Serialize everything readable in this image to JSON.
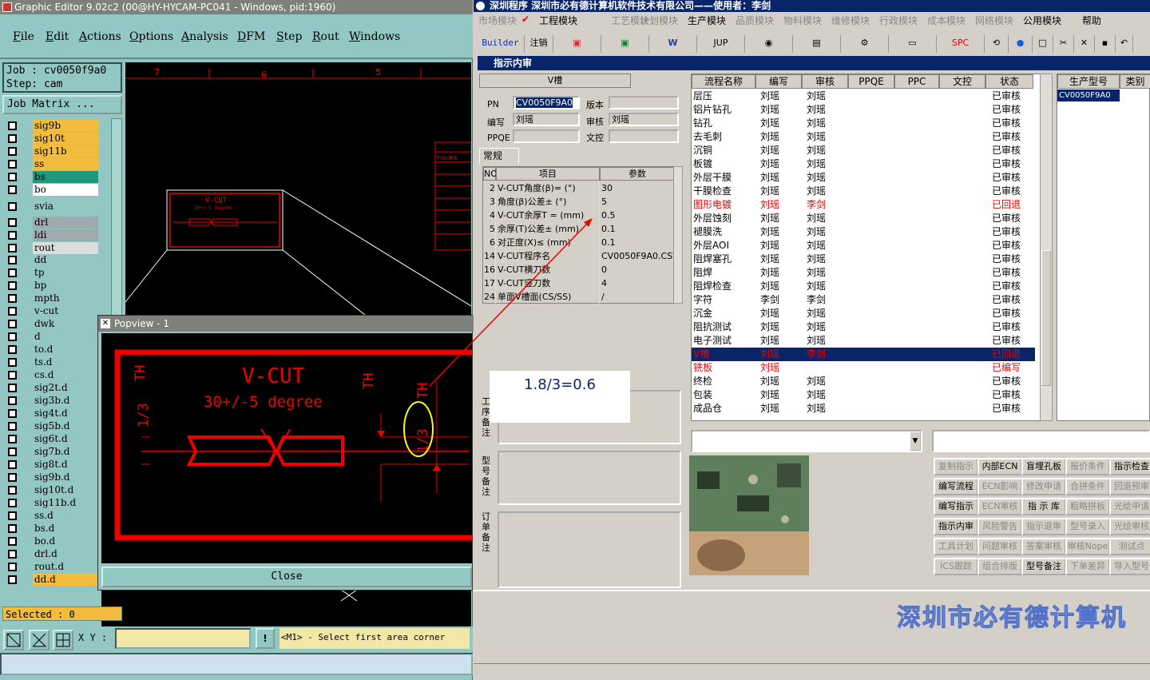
{
  "editor": {
    "title": "Graphic Editor 9.02c2 (00@HY-HYCAM-PC041 - Windows, pid:1960)",
    "menu": [
      "File",
      "Edit",
      "Actions",
      "Options",
      "Analysis",
      "DFM",
      "Step",
      "Rout",
      "Windows"
    ],
    "job": "Job : cv0050f9a0",
    "step": "Step: cam",
    "job_matrix": "Job Matrix ...",
    "layers": [
      {
        "name": "sig9b",
        "color": "#f3bc3c"
      },
      {
        "name": "sig10t",
        "color": "#f3bc3c"
      },
      {
        "name": "sig11b",
        "color": "#f3bc3c"
      },
      {
        "name": "ss",
        "color": "#f3bc3c"
      },
      {
        "name": "bs",
        "color": "#1b9a7c"
      },
      {
        "name": "bo",
        "color": "#ffffff"
      },
      {
        "name": "svia",
        "color": "#93c7c3"
      },
      {
        "name": "drl",
        "color": "#9fa9b0"
      },
      {
        "name": "ldi",
        "color": "#9fa9b0"
      },
      {
        "name": "rout",
        "color": "#dcdcdc"
      },
      {
        "name": "dd",
        "color": "#93c7c3"
      },
      {
        "name": "tp",
        "color": "#93c7c3"
      },
      {
        "name": "bp",
        "color": "#93c7c3"
      },
      {
        "name": "mpth",
        "color": "#93c7c3"
      },
      {
        "name": "v-cut",
        "color": "#93c7c3"
      },
      {
        "name": "dwk",
        "color": "#93c7c3"
      },
      {
        "name": "d",
        "color": "#93c7c3"
      },
      {
        "name": "to.d",
        "color": "#93c7c3"
      },
      {
        "name": "ts.d",
        "color": "#93c7c3"
      },
      {
        "name": "cs.d",
        "color": "#93c7c3"
      },
      {
        "name": "sig2t.d",
        "color": "#93c7c3"
      },
      {
        "name": "sig3b.d",
        "color": "#93c7c3"
      },
      {
        "name": "sig4t.d",
        "color": "#93c7c3"
      },
      {
        "name": "sig5b.d",
        "color": "#93c7c3"
      },
      {
        "name": "sig6t.d",
        "color": "#93c7c3"
      },
      {
        "name": "sig7b.d",
        "color": "#93c7c3"
      },
      {
        "name": "sig8t.d",
        "color": "#93c7c3"
      },
      {
        "name": "sig9b.d",
        "color": "#93c7c3"
      },
      {
        "name": "sig10t.d",
        "color": "#93c7c3"
      },
      {
        "name": "sig11b.d",
        "color": "#93c7c3"
      },
      {
        "name": "ss.d",
        "color": "#93c7c3"
      },
      {
        "name": "bs.d",
        "color": "#93c7c3"
      },
      {
        "name": "bo.d",
        "color": "#93c7c3"
      },
      {
        "name": "drl.d",
        "color": "#93c7c3"
      },
      {
        "name": "rout.d",
        "color": "#93c7c3"
      },
      {
        "name": "dd.d",
        "color": "#f3bc3c"
      }
    ],
    "selected": "Selected : 0",
    "xy_label": "X Y :",
    "status": "<M1> - Select first area corner",
    "ruler": [
      "7",
      "6",
      "5"
    ],
    "canvas_fig_label": "FIGURE",
    "popview": {
      "title": "Popview - 1",
      "vcut_title": "V-CUT",
      "vcut_sub": "30+/-5 degree",
      "th": "TH",
      "ratio": "1/3",
      "close": "Close"
    }
  },
  "app": {
    "title": "深圳程序    深圳市必有德计算机软件技术有限公司——使用者：李剑",
    "menu": [
      {
        "label": "市场模块",
        "active": false
      },
      {
        "label": "工程模块",
        "active": true
      },
      {
        "label": "工艺模块",
        "active": false
      },
      {
        "label": "计划模块",
        "active": false
      },
      {
        "label": "生产模块",
        "active": true
      },
      {
        "label": "品质模块",
        "active": false
      },
      {
        "label": "物料模块",
        "active": false
      },
      {
        "label": "维修模块",
        "active": false
      },
      {
        "label": "行政模块",
        "active": false
      },
      {
        "label": "成本模块",
        "active": false
      },
      {
        "label": "网络模块",
        "active": false
      },
      {
        "label": "公用模块",
        "active": true
      },
      {
        "label": "帮助",
        "active": true
      }
    ],
    "toolbar": [
      "Builder",
      "注销",
      "",
      "",
      "W",
      "JUP",
      "",
      "",
      "",
      "",
      "SPC",
      "",
      "",
      "",
      "",
      "",
      "",
      ""
    ],
    "subwindow_title": "指示内审",
    "form": {
      "heading": "V槽",
      "pn_label": "PN",
      "pn_value": "CV0050F9A0",
      "version_label": "版本",
      "version_value": "",
      "writer_label": "编写",
      "writer_value": "刘瑶",
      "review_label": "审核",
      "review_value": "刘瑶",
      "ppqe_label": "PPQE",
      "ppqe_value": "",
      "doc_label": "文控",
      "doc_value": ""
    },
    "tab_general": "常规",
    "params": {
      "headers": [
        "NO",
        "项目",
        "参数"
      ],
      "rows": [
        [
          "2",
          "V-CUT角度(β)=  (°)",
          "30"
        ],
        [
          "3",
          "角度(β)公差±  (°)",
          "5"
        ],
        [
          "4",
          "V-CUT余厚T =  (mm)",
          "0.5"
        ],
        [
          "5",
          "余厚(T)公差±  (mm)",
          "0.1"
        ],
        [
          "6",
          "对正度(X)≤  (mm)",
          "0.1"
        ],
        [
          "14",
          "V-CUT程序名",
          "CV0050F9A0.CSV"
        ],
        [
          "16",
          "V-CUT横刀数",
          "0"
        ],
        [
          "17",
          "V-CUT竖刀数",
          "4"
        ],
        [
          "24",
          "单面V槽面(CS/SS)",
          "/"
        ]
      ]
    },
    "memo_labels": [
      "工序备注",
      "型号备注",
      "订单备注"
    ],
    "annotation": "1.8/3=0.6",
    "flow": {
      "headers": [
        "流程名称",
        "编写",
        "审核",
        "PPQE",
        "PPC",
        "文控",
        "状态"
      ],
      "rows": [
        {
          "name": "层压",
          "w": "刘瑶",
          "r": "刘瑶",
          "s": "已审核",
          "red": false,
          "sel": false
        },
        {
          "name": "铝片钻孔",
          "w": "刘瑶",
          "r": "刘瑶",
          "s": "已审核",
          "red": false,
          "sel": false
        },
        {
          "name": "钻孔",
          "w": "刘瑶",
          "r": "刘瑶",
          "s": "已审核",
          "red": false,
          "sel": false
        },
        {
          "name": "去毛刺",
          "w": "刘瑶",
          "r": "刘瑶",
          "s": "已审核",
          "red": false,
          "sel": false
        },
        {
          "name": "沉铜",
          "w": "刘瑶",
          "r": "刘瑶",
          "s": "已审核",
          "red": false,
          "sel": false
        },
        {
          "name": "板镀",
          "w": "刘瑶",
          "r": "刘瑶",
          "s": "已审核",
          "red": false,
          "sel": false
        },
        {
          "name": "外层干膜",
          "w": "刘瑶",
          "r": "刘瑶",
          "s": "已审核",
          "red": false,
          "sel": false
        },
        {
          "name": "干膜检查",
          "w": "刘瑶",
          "r": "刘瑶",
          "s": "已审核",
          "red": false,
          "sel": false
        },
        {
          "name": "图形电镀",
          "w": "刘瑶",
          "r": "李剑",
          "s": "已回退",
          "red": true,
          "sel": false
        },
        {
          "name": "外层蚀刻",
          "w": "刘瑶",
          "r": "刘瑶",
          "s": "已审核",
          "red": false,
          "sel": false
        },
        {
          "name": "褪膜洗",
          "w": "刘瑶",
          "r": "刘瑶",
          "s": "已审核",
          "red": false,
          "sel": false
        },
        {
          "name": "外层AOI",
          "w": "刘瑶",
          "r": "刘瑶",
          "s": "已审核",
          "red": false,
          "sel": false
        },
        {
          "name": "阻焊塞孔",
          "w": "刘瑶",
          "r": "刘瑶",
          "s": "已审核",
          "red": false,
          "sel": false
        },
        {
          "name": "阻焊",
          "w": "刘瑶",
          "r": "刘瑶",
          "s": "已审核",
          "red": false,
          "sel": false
        },
        {
          "name": "阻焊检查",
          "w": "刘瑶",
          "r": "刘瑶",
          "s": "已审核",
          "red": false,
          "sel": false
        },
        {
          "name": "字符",
          "w": "李剑",
          "r": "李剑",
          "s": "已审核",
          "red": false,
          "sel": false
        },
        {
          "name": "沉金",
          "w": "刘瑶",
          "r": "刘瑶",
          "s": "已审核",
          "red": false,
          "sel": false
        },
        {
          "name": "阻抗测试",
          "w": "刘瑶",
          "r": "刘瑶",
          "s": "已审核",
          "red": false,
          "sel": false
        },
        {
          "name": "电子测试",
          "w": "刘瑶",
          "r": "刘瑶",
          "s": "已审核",
          "red": false,
          "sel": false
        },
        {
          "name": "V槽",
          "w": "刘瑶",
          "r": "李剑",
          "s": "已回退",
          "red": true,
          "sel": true
        },
        {
          "name": "铣板",
          "w": "刘瑶",
          "r": "",
          "s": "已编写",
          "red": true,
          "sel": false
        },
        {
          "name": "终检",
          "w": "刘瑶",
          "r": "刘瑶",
          "s": "已审核",
          "red": false,
          "sel": false
        },
        {
          "name": "包装",
          "w": "刘瑶",
          "r": "刘瑶",
          "s": "已审核",
          "red": false,
          "sel": false
        },
        {
          "name": "成品仓",
          "w": "刘瑶",
          "r": "刘瑶",
          "s": "已审核",
          "red": false,
          "sel": false
        }
      ]
    },
    "model": {
      "headers": [
        "生产型号",
        "类别"
      ],
      "value": "CV0050F9A0"
    },
    "buttons": [
      [
        {
          "l": "复制指示",
          "on": false
        },
        {
          "l": "内部ECN",
          "on": true
        },
        {
          "l": "盲埋孔板",
          "on": true
        },
        {
          "l": "报价条件",
          "on": false
        },
        {
          "l": "指示检查",
          "on": true
        }
      ],
      [
        {
          "l": "编写流程",
          "on": true
        },
        {
          "l": "ECN影响",
          "on": false
        },
        {
          "l": "修改申请",
          "on": false
        },
        {
          "l": "合拼条件",
          "on": false
        },
        {
          "l": "回退预审",
          "on": false
        }
      ],
      [
        {
          "l": "编写指示",
          "on": true
        },
        {
          "l": "ECN审核",
          "on": false
        },
        {
          "l": "指 示 库",
          "on": true
        },
        {
          "l": "粗略拼板",
          "on": false
        },
        {
          "l": "光绘申请",
          "on": false
        }
      ],
      [
        {
          "l": "指示内审",
          "on": true
        },
        {
          "l": "风险警告",
          "on": false
        },
        {
          "l": "指示退审",
          "on": false
        },
        {
          "l": "型号录入",
          "on": false
        },
        {
          "l": "光绘审核",
          "on": false
        }
      ],
      [
        {
          "l": "工具计划",
          "on": false
        },
        {
          "l": "问题审核",
          "on": false
        },
        {
          "l": "答案审核",
          "on": false
        },
        {
          "l": "审核Nope",
          "on": false
        },
        {
          "l": "测试点",
          "on": false
        }
      ],
      [
        {
          "l": "ICS跟踪",
          "on": false
        },
        {
          "l": "组合排版",
          "on": false
        },
        {
          "l": "型号备注",
          "on": true
        },
        {
          "l": "下单差异",
          "on": false
        },
        {
          "l": "导入型号",
          "on": false
        }
      ]
    ],
    "brand": "深圳市必有德计算机"
  }
}
